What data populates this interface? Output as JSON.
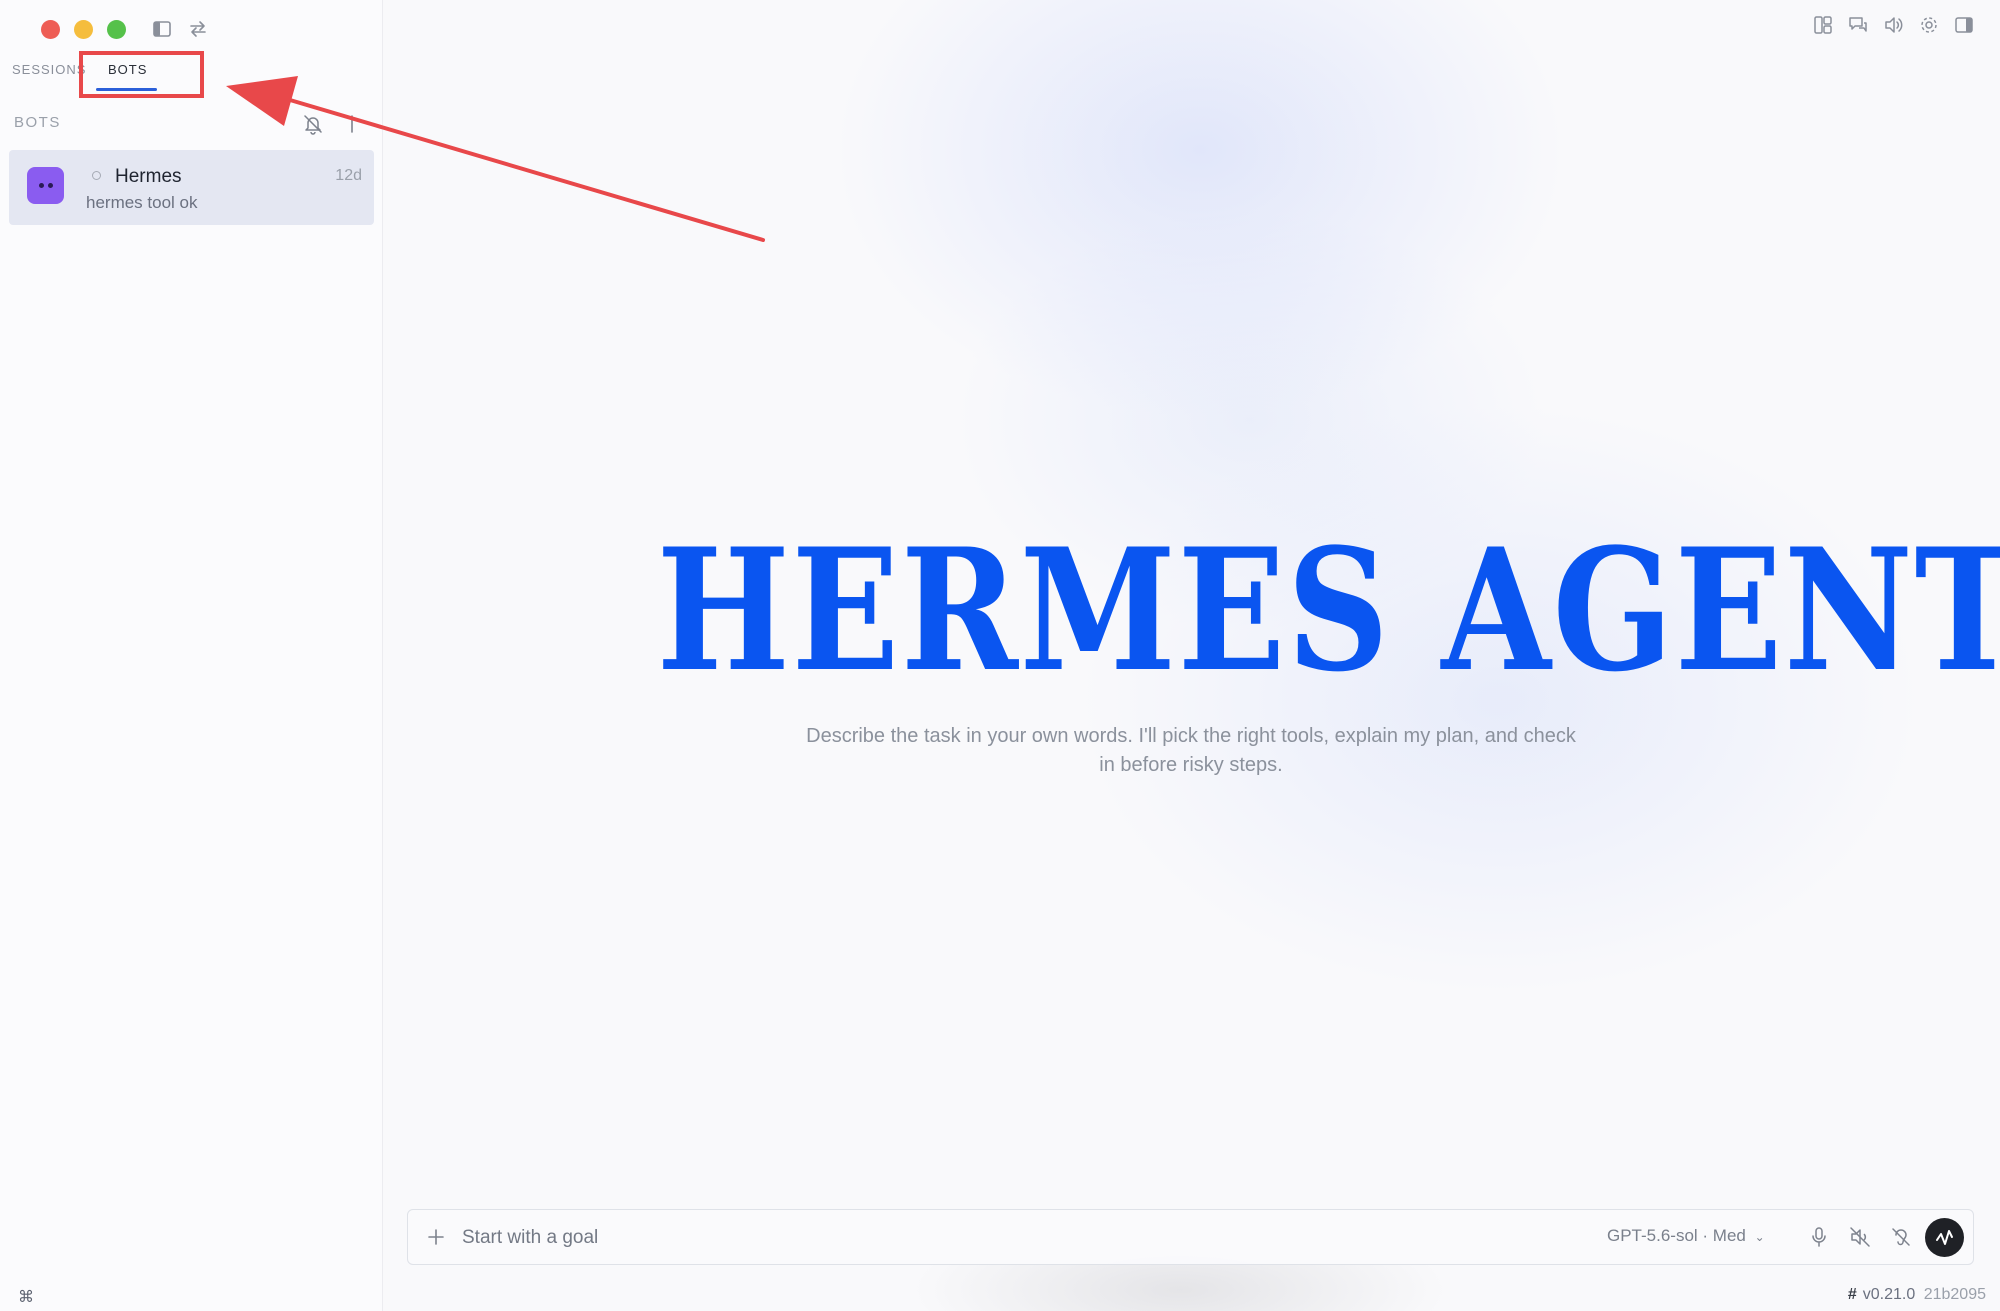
{
  "sidebar": {
    "tabs": [
      {
        "label": "SESSIONS",
        "active": false
      },
      {
        "label": "BOTS",
        "active": true
      }
    ],
    "section_label": "BOTS",
    "bots": [
      {
        "name": "Hermes",
        "time": "12d",
        "preview": "hermes tool ok",
        "avatar_color": "#8a5cf0"
      }
    ]
  },
  "hero": {
    "title": "HERMES AGENT",
    "subtitle_line1": "Describe the task in your own words. I'll pick the right tools, explain my plan, and check",
    "subtitle_line2": "in before risky steps."
  },
  "composer": {
    "placeholder": "Start with a goal",
    "model_label": "GPT-5.6-sol · Med"
  },
  "footer": {
    "hash_symbol": "#",
    "version": "v0.21.0",
    "build": "21b2095"
  },
  "colors": {
    "accent": "#0a55f0",
    "annotation": "#e8484a",
    "tab_underline": "#2b5fd9"
  },
  "icons": {
    "sidebar_toggle": "sidebar-toggle-icon",
    "swap": "swap-icon",
    "toolbar": [
      "layout-icon",
      "chat-icon",
      "speaker-icon",
      "gear-icon",
      "right-panel-icon"
    ],
    "composer": [
      "plus-icon",
      "microphone-icon",
      "voice-off-icon",
      "hearing-off-icon",
      "waveform-icon"
    ]
  }
}
